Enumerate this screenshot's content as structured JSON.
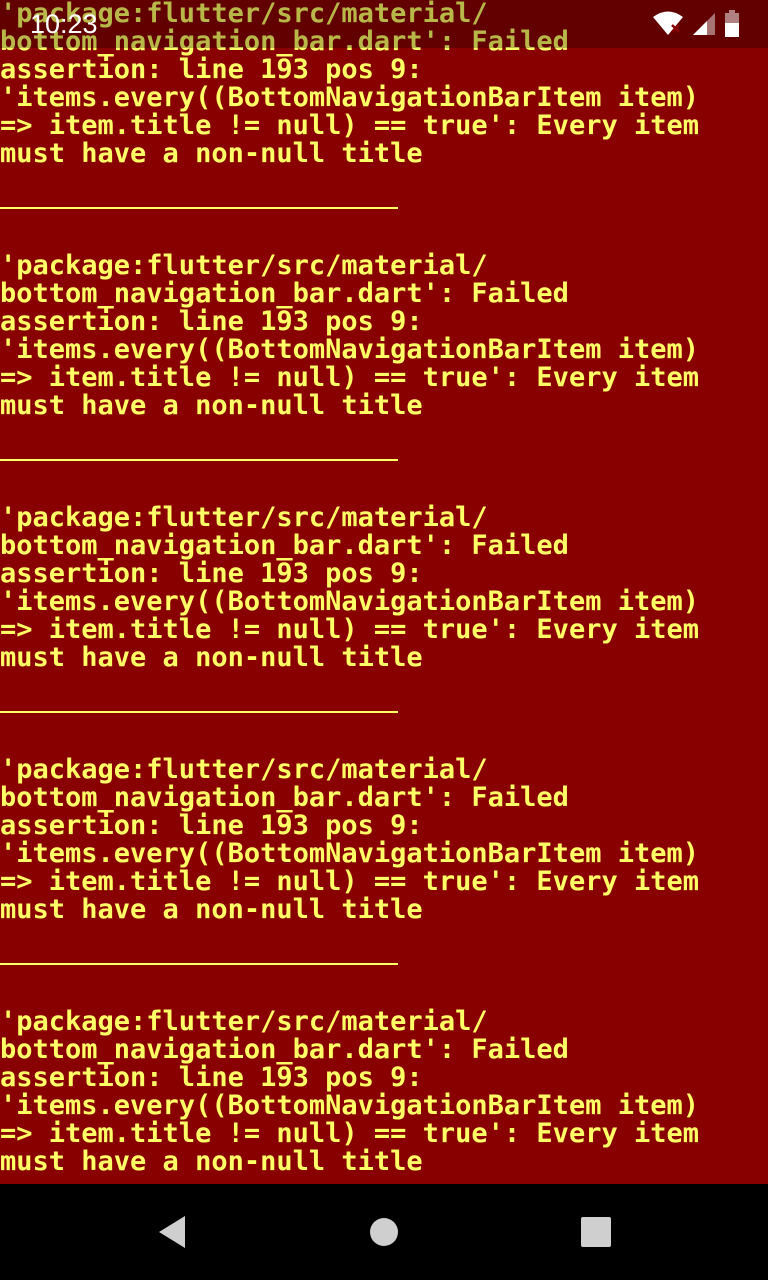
{
  "status_bar": {
    "time": "10:23",
    "icons": [
      "wifi-icon",
      "signal-icon",
      "battery-icon"
    ]
  },
  "error": {
    "lines": [
      "'package:flutter/src/material/",
      "bottom_navigation_bar.dart': Failed",
      "assertion: line 193 pos 9:",
      "'items.every((BottomNavigationBarItem item)",
      "=> item.title != null) == true': Every item",
      "must have a non-null title"
    ],
    "repeat_count": 5,
    "text_color": "#ffff66",
    "background_color": "#880000"
  },
  "nav_bar": {
    "buttons": [
      "back-icon",
      "home-icon",
      "recents-icon"
    ]
  }
}
